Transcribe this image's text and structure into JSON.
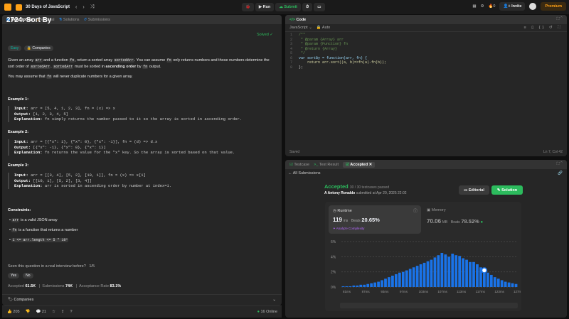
{
  "topbar": {
    "list_title": "30 Days of JavaScript",
    "run": "Run",
    "submit": "Submit",
    "invite": "Invite",
    "premium": "Premium",
    "streak": "0",
    "timer": "0"
  },
  "left": {
    "tabs": [
      "Description",
      "Editorial",
      "Solutions",
      "Submissions"
    ],
    "title": "2724. Sort By",
    "solved": "Solved",
    "difficulty": "Easy",
    "companies_chip": "Companies",
    "p1a": "Given an array",
    "p1b": "arr",
    "p1c": "and a function",
    "p1d": "fn",
    "p1e": ", return a sorted array",
    "p1f": "sortedArr",
    "p1g": ". You can assume",
    "p1h": "fn",
    "p1i": "only returns numbers and those numbers",
    "p2a": "determine the sort order of",
    "p2b": "sortedArr",
    "p2c": ".",
    "p2d": "sortedArr",
    "p2e": "must be sorted in",
    "p2f": "ascending order",
    "p2g": "by",
    "p2h": "fn",
    "p2i": "output.",
    "p3a": "You may assume that",
    "p3b": "fn",
    "p3c": "will never duplicate numbers for a given array.",
    "ex1_head": "Example 1:",
    "ex1_in": "arr = [5, 4, 1, 2, 3], fn = (x) => x",
    "ex1_out": "[1, 2, 3, 4, 5]",
    "ex1_exp": "fn simply returns the number passed to it so the array is sorted in ascending order.",
    "ex2_head": "Example 2:",
    "ex2_in": "arr = [{\"x\": 1}, {\"x\": 0}, {\"x\": -1}], fn = (d) => d.x",
    "ex2_out": "[{\"x\": -1}, {\"x\": 0}, {\"x\": 1}]",
    "ex2_exp": "fn returns the value for the \"x\" key. So the array is sorted based on that value.",
    "ex3_head": "Example 3:",
    "ex3_in": "arr = [[3, 4], [5, 2], [10, 1]], fn = (x) => x[1]",
    "ex3_out": "[[10, 1], [5, 2], [3, 4]]",
    "ex3_exp": "arr is sorted in ascending order by number at index=1.",
    "input_lbl": "Input:",
    "output_lbl": "Output:",
    "expl_lbl": "Explanation:",
    "constraints": "Constraints:",
    "c1a": "arr",
    "c1b": "is a valid JSON array",
    "c2a": "fn",
    "c2b": "is a function that returns a number",
    "c3": "1 <= arr.length <= 5 * 10⁵",
    "interview": "Seen this question in a real interview before?",
    "interview_count": "1/5",
    "yes": "Yes",
    "no": "No",
    "accepted_lbl": "Accepted",
    "accepted": "61.5K",
    "subs_lbl": "Submissions",
    "subs": "74K",
    "rate_lbl": "Acceptance Rate",
    "rate": "83.1%",
    "companies": "Companies",
    "likes": "205",
    "comments": "21",
    "online": "16 Online"
  },
  "code": {
    "title": "Code",
    "lang": "JavaScript",
    "auto": "Auto",
    "saved": "Saved",
    "pos": "Ln 7, Col 42",
    "lines": [
      "/**",
      " * @param {Array} arr",
      " * @param {Function} fn",
      " * @return {Array}",
      " */",
      "var sortBy = function(arr, fn) {",
      "    return arr.sort((a, b)=>fn(a)-fn(b));",
      "};"
    ],
    "line_numbers": [
      "1",
      "2",
      "3",
      "4",
      "5",
      "6",
      "7",
      "8"
    ]
  },
  "result": {
    "tabs": [
      "Testcase",
      "Test Result",
      "Accepted"
    ],
    "back": "All Submissions",
    "status": "Accepted",
    "passed": "30 / 30 testcases passed",
    "author": "A Antony Ronaldo",
    "submitted": "submitted at Apr 20, 2025 22:02",
    "editorial": "Editorial",
    "solution": "Solution",
    "runtime_lbl": "Runtime",
    "runtime": "119",
    "runtime_unit": "ms",
    "beats_lbl": "Beats",
    "beats": "20.65%",
    "analyze": "Analyze Complexity",
    "memory_lbl": "Memory",
    "memory": "70.06",
    "memory_unit": "MB",
    "mem_beats": "78.52%"
  },
  "chart_data": {
    "type": "bar",
    "y_ticks": [
      "6%",
      "4%",
      "2%",
      "0%"
    ],
    "ylim": [
      0,
      6
    ],
    "x_labels": [
      "81ms",
      "87ms",
      "93ms",
      "97ms",
      "103ms",
      "107ms",
      "113ms",
      "117ms",
      "123ms",
      "127ms"
    ],
    "values": [
      0.1,
      0.1,
      0.1,
      0.2,
      0.2,
      0.3,
      0.3,
      0.4,
      0.5,
      0.6,
      0.7,
      0.9,
      1.1,
      1.3,
      1.5,
      1.7,
      1.9,
      2.0,
      2.2,
      2.4,
      2.6,
      2.8,
      3.0,
      3.2,
      3.4,
      3.6,
      3.9,
      4.2,
      4.5,
      4.3,
      4.0,
      4.4,
      4.2,
      4.1,
      3.8,
      3.6,
      3.3,
      3.3,
      3.0,
      2.6,
      2.2,
      1.9,
      1.6,
      1.3,
      1.1,
      0.9,
      0.7,
      0.6,
      0.5,
      0.4
    ],
    "highlight_index": 40,
    "bar_color": "#1a73e8",
    "highlight_color": "#ffffff"
  }
}
